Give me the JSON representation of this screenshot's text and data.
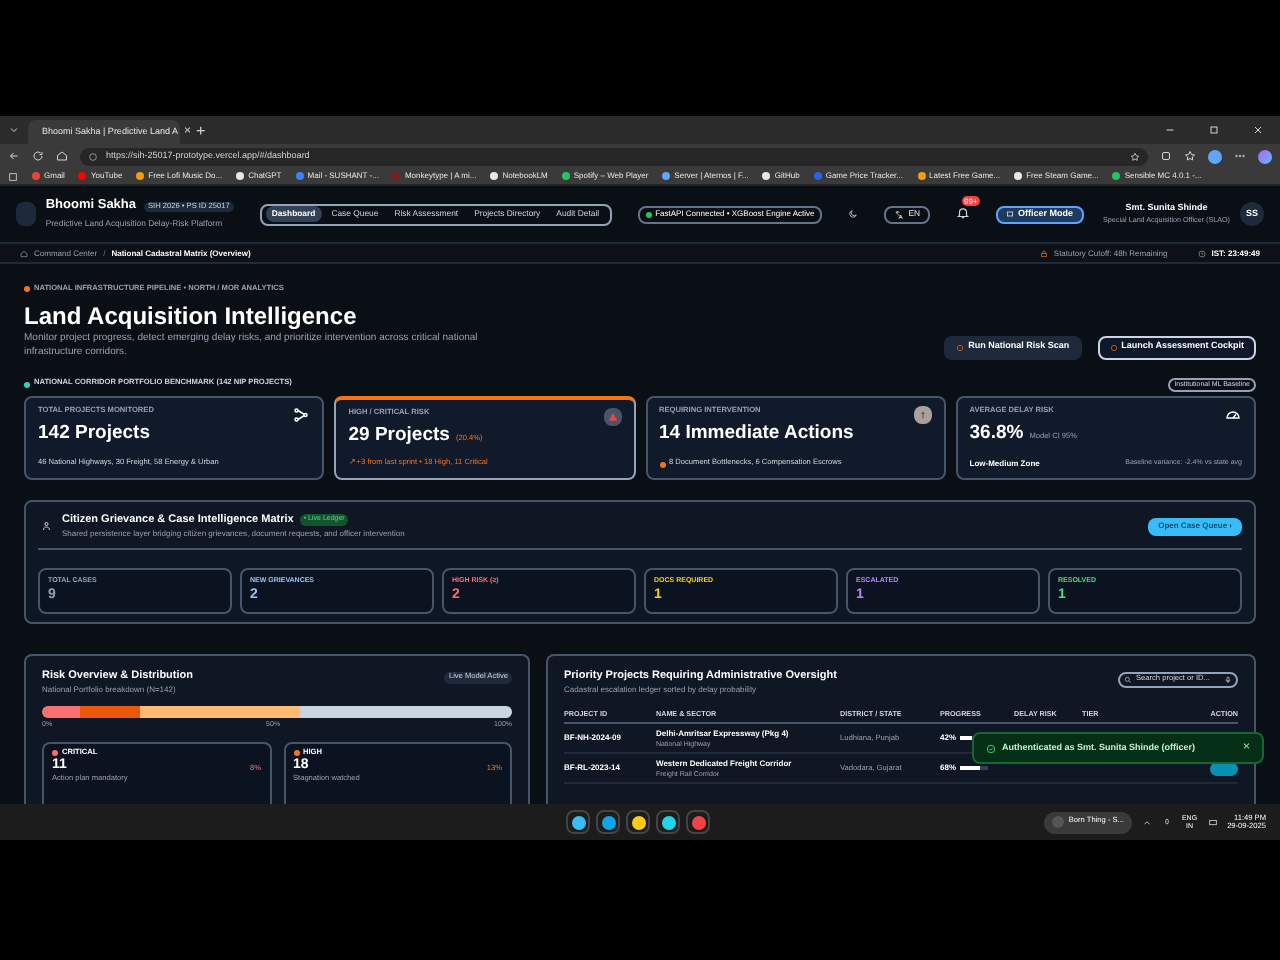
{
  "browser": {
    "tab_title": "Bhoomi Sakha | Predictive Land A",
    "tab_close": "×",
    "new_tab": "+",
    "url": "https://sih-25017-prototype.vercel.app/#/dashboard",
    "bookmarks": [
      "Gmail",
      "YouTube",
      "Free Lofi Music Do...",
      "ChatGPT",
      "Mail - SUSHANT -...",
      "Monkeytype | A mi...",
      "NotebookLM",
      "Spotify – Web Player",
      "Server | Aternos | F...",
      "GitHub",
      "Game Price Tracker...",
      "Latest Free Game...",
      "Free Steam Game...",
      "Sensible MC 4.0.1 -..."
    ]
  },
  "header": {
    "brand": "Bhoomi Sakha",
    "badge": "SIH 2026 • PS ID 25017",
    "subtitle": "Predictive Land Acquisition Delay-Risk Platform",
    "nav": [
      {
        "label": "Dashboard",
        "selected": true
      },
      {
        "label": "Case Queue",
        "selected": false
      },
      {
        "label": "Risk Assessment",
        "selected": false
      },
      {
        "label": "Projects Directory",
        "selected": false
      },
      {
        "label": "Audit Detail",
        "selected": false
      }
    ],
    "status": "FastAPI Connected • XGBoost Engine Active",
    "language": "EN",
    "notification_count": "99+",
    "mode_button": "Officer Mode",
    "user": {
      "name": "Smt. Sunita Shinde",
      "role": "Special Land Acquisition Officer (SLAO)",
      "initials": "SS"
    }
  },
  "breadcrumb": {
    "items": [
      "Command Center",
      "National Cadastral Matrix (Overview)"
    ],
    "separator": "/",
    "cutoff": "Statutory Cutoff: 48h Remaining",
    "clock": "IST: 23:49:49"
  },
  "hero": {
    "eyebrow": "NATIONAL INFRASTRUCTURE PIPELINE • NORTH / MOR ANALYTICS",
    "title": "Land Acquisition Intelligence",
    "description": "Monitor project progress, detect emerging delay risks, and prioritize intervention across critical national infrastructure corridors.",
    "buttons": [
      {
        "label": "Run National Risk Scan",
        "kind": "secondary"
      },
      {
        "label": "Launch Assessment Cockpit",
        "kind": "outline"
      }
    ]
  },
  "benchmark": {
    "label": "NATIONAL CORRIDOR PORTFOLIO BENCHMARK (142 NIP PROJECTS)",
    "badge": "Institutional ML Baseline",
    "cards": [
      {
        "kind": "plain",
        "title": "TOTAL PROJECTS MONITORED",
        "value": "142 Projects",
        "footnote": "46 National Highways, 30 Freight, 58 Energy & Urban",
        "highlighted": false
      },
      {
        "kind": "alert",
        "title": "HIGH / CRITICAL RISK",
        "value": "29 Projects",
        "value_note": "(20.4%)",
        "footnote": "↗ +3 from last sprint • 18 High, 11 Critical",
        "highlighted": true
      },
      {
        "kind": "action",
        "title": "REQUIRING INTERVENTION",
        "value": "14 Immediate Actions",
        "footnote": "8 Document Bottlenecks, 6 Compensation Escrows",
        "highlighted": false
      },
      {
        "kind": "gauge",
        "title": "AVERAGE DELAY RISK",
        "value": "36.8%",
        "value_note": "Model CI 95%",
        "footnote": "Low-Medium Zone",
        "footnote_right": "Baseline variance: -2.4% vs state avg",
        "highlighted": false
      }
    ]
  },
  "grievance": {
    "title": "Citizen Grievance & Case Intelligence Matrix",
    "badge": "• Live Ledger",
    "subtitle": "Shared persistence layer bridging citizen grievances, document requests, and officer intervention",
    "button": "Open Case Queue ›",
    "stats": [
      {
        "label": "TOTAL CASES",
        "value": "9",
        "color": "#94a3b8"
      },
      {
        "label": "NEW GRIEVANCES",
        "value": "2",
        "color": "#93c5fd"
      },
      {
        "label": "HIGH RISK (≥)",
        "value": "2",
        "color": "#f87171"
      },
      {
        "label": "DOCS REQUIRED",
        "value": "1",
        "color": "#facc15"
      },
      {
        "label": "ESCALATED",
        "value": "1",
        "color": "#c084fc"
      },
      {
        "label": "RESOLVED",
        "value": "1",
        "color": "#4ade80"
      }
    ]
  },
  "risk": {
    "title": "Risk Overview & Distribution",
    "subtitle": "National Portfolio breakdown (N=142)",
    "badge": "Live Model Active",
    "segments": [
      {
        "level": 0.08,
        "color": "#f87171"
      },
      {
        "level": 0.13,
        "color": "#ea580c"
      },
      {
        "level": 0.34,
        "color": "#fdba74"
      },
      {
        "level": 0.45,
        "color": "#cbd5e1"
      }
    ],
    "axis": [
      "0%",
      "50%",
      "100%"
    ],
    "tiers": [
      {
        "label": "CRITICAL",
        "value": "11",
        "share": "8%",
        "note": "Action plan mandatory",
        "color": "#f87171"
      },
      {
        "label": "HIGH",
        "value": "18",
        "share": "13%",
        "note": "Stagnation watched",
        "color": "#f97316"
      }
    ]
  },
  "priority": {
    "title": "Priority Projects Requiring Administrative Oversight",
    "subtitle": "Cadastral escalation ledger sorted by delay probability",
    "search": {
      "placeholder": "Search project or ID..."
    },
    "columns": [
      "PROJECT ID",
      "NAME & SECTOR",
      "DISTRICT / STATE",
      "PROGRESS",
      "DELAY RISK",
      "TIER",
      "ACTION"
    ],
    "rows": [
      {
        "id": "BF-NH-2024-09",
        "name": "Delhi-Amritsar Expressway (Pkg 4)",
        "sector": "National Highway",
        "district": "Ludhiana, Punjab",
        "progress": "42%",
        "level": 0.42
      },
      {
        "id": "BF-RL-2023-14",
        "name": "Western Dedicated Freight Corridor",
        "sector": "Freight Rail Corridor",
        "district": "Vadodara, Gujarat",
        "progress": "68%",
        "level": 0.68
      }
    ]
  },
  "toast": {
    "message": "Authenticated as Smt. Sunita Shinde (officer)",
    "close": "×"
  },
  "taskbar": {
    "media_title": "Born Thing - S...",
    "language": "ENG",
    "region": "IN",
    "time": "11:49 PM",
    "date": "29-09-2025"
  }
}
